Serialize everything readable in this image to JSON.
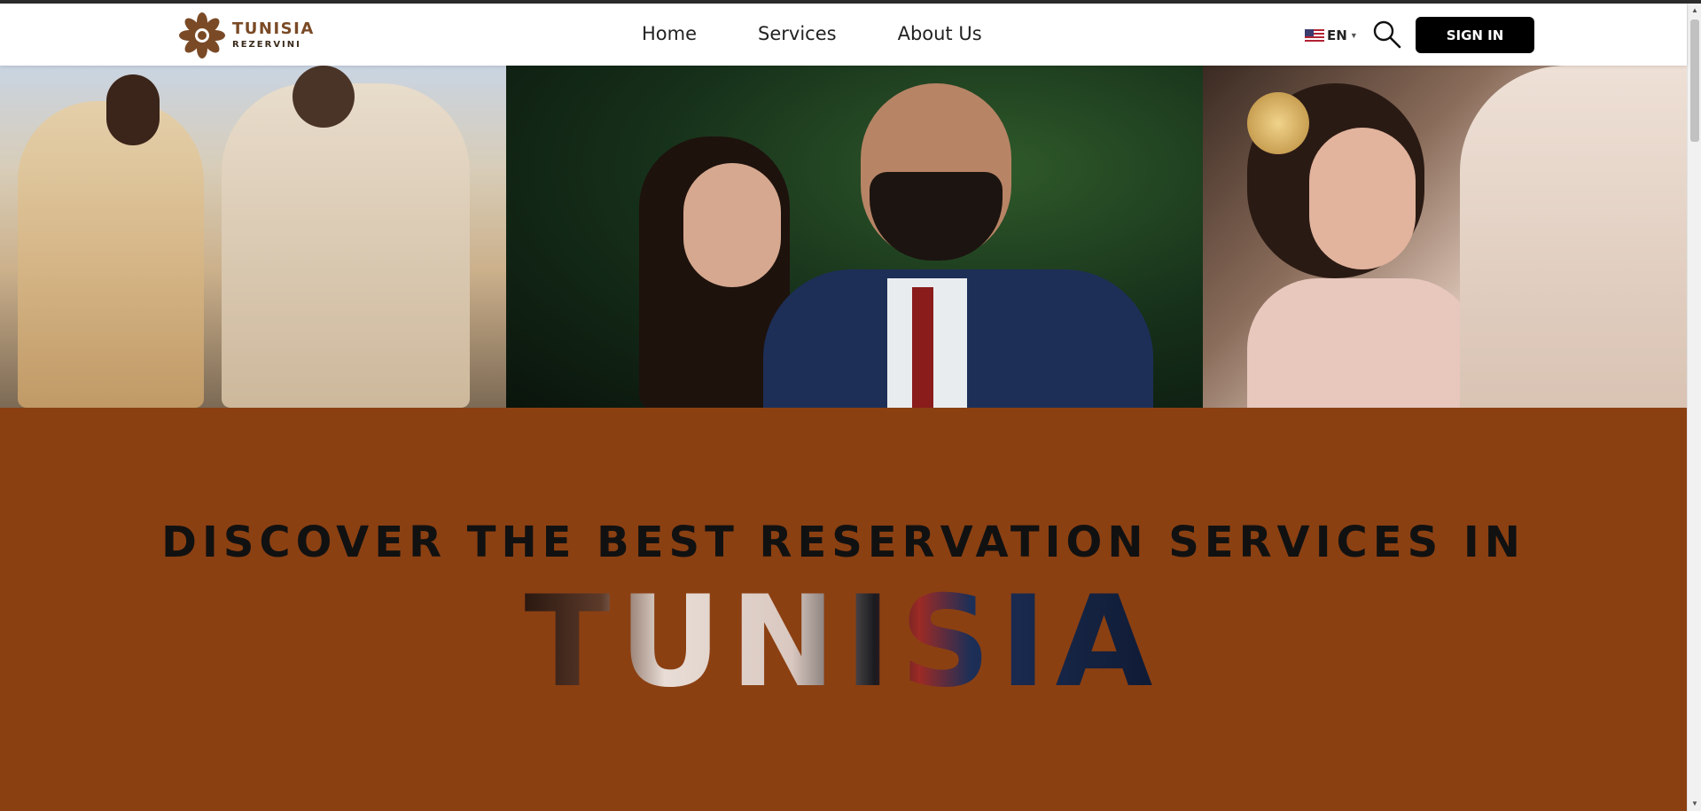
{
  "brand": {
    "name_line1": "TUNISIA",
    "name_line2": "REZERVINI",
    "logo_icon": "flower-logo-icon",
    "brand_color": "#7a4a26"
  },
  "nav": {
    "items": [
      {
        "label": "Home"
      },
      {
        "label": "Services"
      },
      {
        "label": "About Us"
      }
    ]
  },
  "header_actions": {
    "language_code": "EN",
    "language_flag": "us-flag-icon",
    "search_icon": "search-icon",
    "signin_label": "SIGN IN"
  },
  "hero": {
    "photos": [
      "couple-traditional-dress-photo",
      "couple-suit-photo",
      "couple-embrace-photo"
    ]
  },
  "promo": {
    "headline": "DISCOVER THE BEST RESERVATION SERVICES IN",
    "big_word": "TUNISIA",
    "background_color": "#8b4012"
  }
}
